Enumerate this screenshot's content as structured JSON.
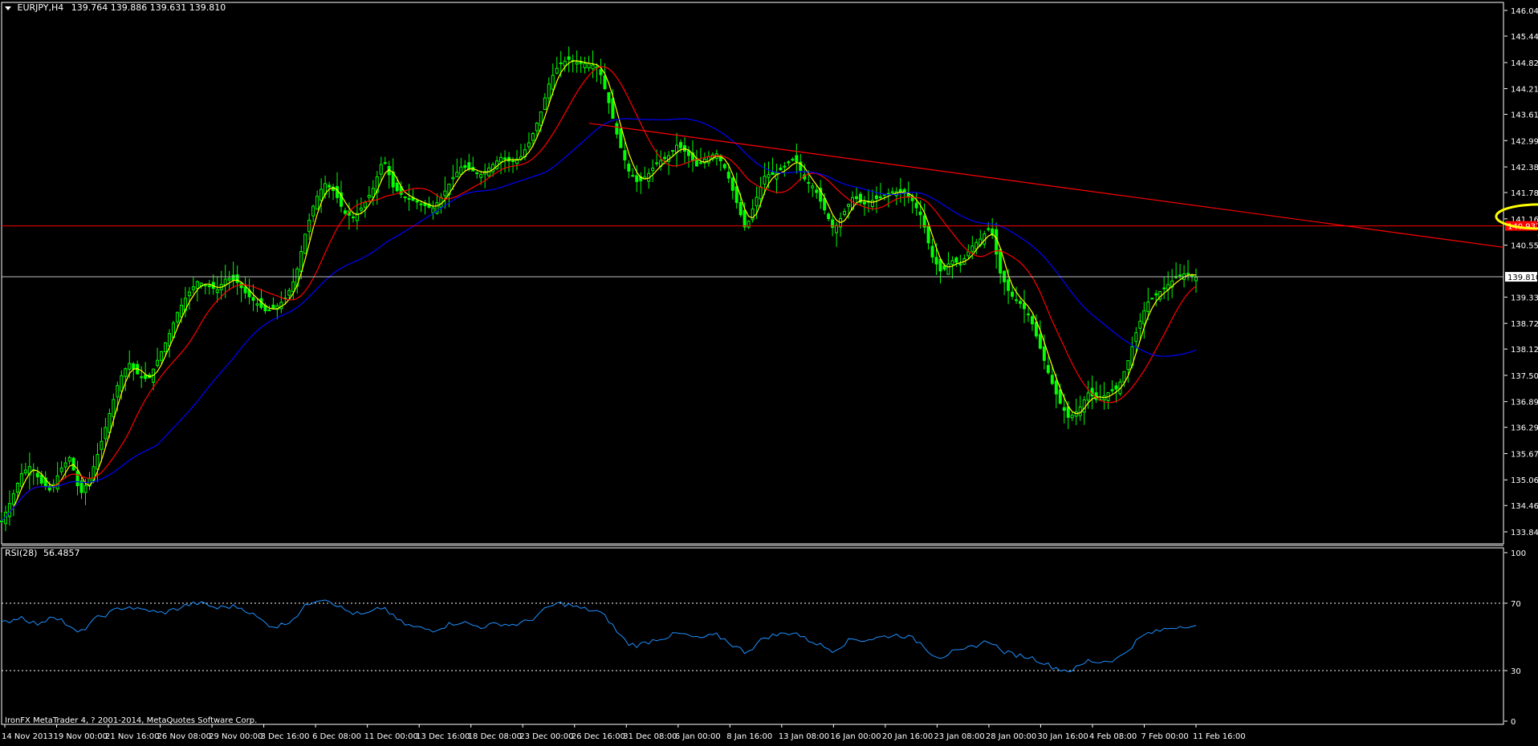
{
  "header": {
    "symbol": "EURJPY,H4",
    "quote": "139.764 139.886 139.631 139.810"
  },
  "rsi_header": {
    "name": "RSI(28)",
    "value": "56.4857"
  },
  "footer": {
    "copyright": "IronFX MetaTrader 4, ? 2001-2014, MetaQuotes Software Corp."
  },
  "colors": {
    "background": "#000000",
    "candles": "#00ff00",
    "ma_fast": "#ffff00",
    "ma_mid": "#ff0000",
    "ma_slow": "#0000ff",
    "rsi_line": "#1e90ff",
    "trendline": "#ff0000",
    "annotation": "#ffff00",
    "grid_text": "#ffffff",
    "price_line": "#c0c0c0",
    "level_label_bg": "#ff0000"
  },
  "chart_data": [
    {
      "type": "candlestick",
      "title": "EURJPY,H4",
      "y_axis_ticks": [
        146.04,
        145.44,
        144.82,
        144.21,
        143.61,
        142.995,
        142.38,
        141.78,
        141.165,
        140.55,
        139.335,
        138.72,
        138.12,
        137.505,
        136.89,
        136.29,
        135.675,
        135.06,
        134.46,
        133.845
      ],
      "ylim": [
        133.845,
        146.04
      ],
      "x_tick_labels": [
        "14 Nov 2013",
        "19 Nov 00:00",
        "21 Nov 16:00",
        "26 Nov 08:00",
        "29 Nov 00:00",
        "3 Dec 16:00",
        "6 Dec 08:00",
        "11 Dec 00:00",
        "13 Dec 16:00",
        "18 Dec 08:00",
        "23 Dec 00:00",
        "26 Dec 16:00",
        "31 Dec 08:00",
        "6 Jan 00:00",
        "8 Jan 16:00",
        "13 Jan 08:00",
        "16 Jan 00:00",
        "20 Jan 16:00",
        "23 Jan 08:00",
        "28 Jan 00:00",
        "30 Jan 16:00",
        "4 Feb 08:00",
        "7 Feb 00:00",
        "11 Feb 16:00"
      ],
      "close_path": [
        134.1,
        134.6,
        135.2,
        135.4,
        135.0,
        134.8,
        135.3,
        135.6,
        134.7,
        135.1,
        135.8,
        136.6,
        137.4,
        137.8,
        137.5,
        137.4,
        137.9,
        138.4,
        139.0,
        139.4,
        139.7,
        139.6,
        139.5,
        139.8,
        139.7,
        139.4,
        139.2,
        139.0,
        139.1,
        139.3,
        139.8,
        140.8,
        141.6,
        142.0,
        141.8,
        141.3,
        141.2,
        141.5,
        141.9,
        142.6,
        141.9,
        141.7,
        141.6,
        141.5,
        141.4,
        141.7,
        142.1,
        142.4,
        142.3,
        142.2,
        142.4,
        142.6,
        142.5,
        142.6,
        143.0,
        143.6,
        144.4,
        144.8,
        144.9,
        144.8,
        144.8,
        144.7,
        143.9,
        143.0,
        142.3,
        142.0,
        142.2,
        142.5,
        142.6,
        142.9,
        142.7,
        142.4,
        142.6,
        142.7,
        142.3,
        141.6,
        140.9,
        141.6,
        142.2,
        142.2,
        142.4,
        142.6,
        142.1,
        141.9,
        141.4,
        140.9,
        141.3,
        141.7,
        141.5,
        141.6,
        141.7,
        141.8,
        141.8,
        141.6,
        141.2,
        140.3,
        139.9,
        140.2,
        140.1,
        140.5,
        140.7,
        141.0,
        139.9,
        139.4,
        139.2,
        138.9,
        138.2,
        137.5,
        136.9,
        136.5,
        136.7,
        137.1,
        136.9,
        137.1,
        137.2,
        137.8,
        138.6,
        139.2,
        139.4,
        139.6,
        139.8,
        139.9,
        139.8
      ],
      "series": [
        {
          "name": "",
          "kind": "ma_fast"
        },
        {
          "name": "",
          "kind": "ma_mid"
        },
        {
          "name": "",
          "kind": "ma_slow"
        }
      ],
      "horizontal_levels": [
        {
          "price": 141.0,
          "label": "140.937",
          "color": "#ff0000"
        },
        {
          "price": 139.81,
          "label": "139.810",
          "color": "#c0c0c0"
        }
      ],
      "trendline": {
        "from": {
          "x_index": 60,
          "y": 143.4
        },
        "to": {
          "x_index": 200,
          "y": 140.5
        }
      },
      "annotations": [
        {
          "kind": "ellipse",
          "center_x_index": 157,
          "center_y": 141.22
        },
        {
          "kind": "arrow_line",
          "from_x_index": 157,
          "from_y": 140.8,
          "to_x_index": 163,
          "to_y": 136.9
        }
      ]
    },
    {
      "type": "line",
      "title": "RSI(28) 56.4857",
      "y_axis_ticks": [
        100,
        70,
        30,
        0
      ],
      "ylim": [
        0,
        100
      ],
      "levels": [
        70,
        30
      ],
      "values": [
        58,
        60,
        62,
        59,
        57,
        63,
        61,
        55,
        52,
        58,
        62,
        64,
        67,
        68,
        66,
        66,
        64,
        65,
        67,
        69,
        70,
        69,
        67,
        68,
        68,
        66,
        62,
        58,
        56,
        58,
        62,
        68,
        72,
        73,
        70,
        66,
        64,
        63,
        65,
        68,
        62,
        58,
        56,
        55,
        54,
        56,
        58,
        59,
        57,
        56,
        57,
        58,
        57,
        58,
        60,
        64,
        68,
        70,
        69,
        67,
        66,
        65,
        60,
        52,
        46,
        45,
        47,
        49,
        50,
        52,
        51,
        49,
        50,
        51,
        48,
        44,
        41,
        45,
        50,
        51,
        52,
        53,
        49,
        47,
        44,
        42,
        46,
        49,
        48,
        49,
        50,
        51,
        51,
        49,
        46,
        40,
        38,
        41,
        41,
        44,
        46,
        48,
        42,
        40,
        39,
        38,
        36,
        33,
        31,
        30,
        32,
        36,
        35,
        36,
        37,
        42,
        48,
        52,
        53,
        55,
        56,
        57,
        56
      ]
    }
  ]
}
